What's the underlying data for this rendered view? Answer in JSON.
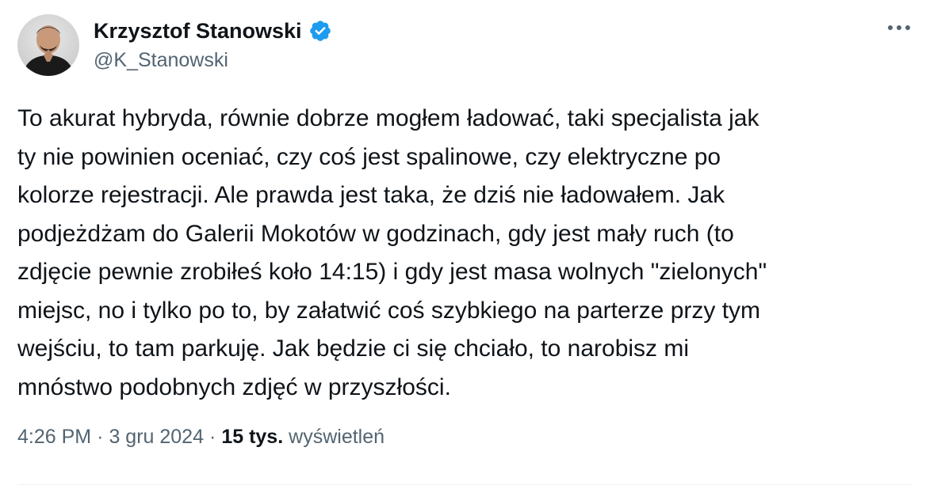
{
  "author": {
    "display_name": "Krzysztof Stanowski",
    "handle": "@K_Stanowski",
    "verified": true
  },
  "tweet": {
    "text": "To akurat hybryda, równie dobrze mogłem ładować, taki specjalista jak\nty nie powinien oceniać, czy coś jest spalinowe, czy elektryczne po\nkolorze rejestracji. Ale prawda jest taka, że dziś nie ładowałem. Jak\npodjeżdżam do Galerii Mokotów w godzinach, gdy jest mały ruch (to\nzdjęcie pewnie zrobiłeś koło 14:15) i gdy jest masa wolnych \"zielonych\"\nmiejsc, no i tylko po to, by załatwić coś szybkiego na parterze przy tym\nwejściu, to tam parkuję. Jak będzie ci się chciało, to narobisz mi\nmnóstwo podobnych zdjęć w przyszłości.",
    "time": "4:26 PM",
    "separator": "·",
    "date": "3 gru 2024",
    "views_count": "15 tys.",
    "views_label": "wyświetleń"
  },
  "icons": {
    "verified": "verified-badge-icon",
    "more": "more-horizontal-icon"
  },
  "colors": {
    "verified_blue": "#1d9bf0",
    "text_primary": "#0f1419",
    "text_secondary": "#536471"
  }
}
